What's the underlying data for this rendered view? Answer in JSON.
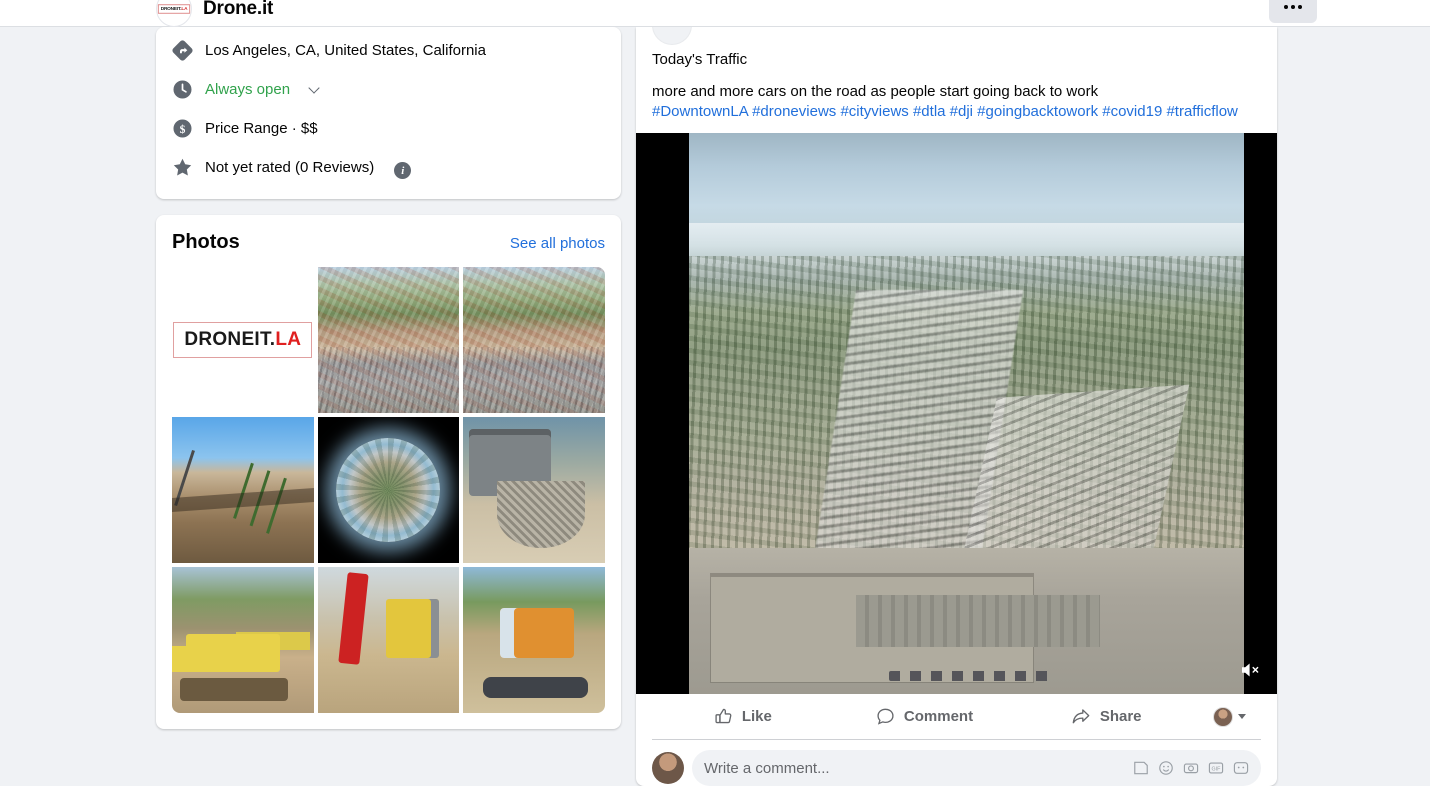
{
  "header": {
    "page_name": "Drone.it",
    "logo_black": "DRONEIT.",
    "logo_red": "LA",
    "menu_label": "···"
  },
  "sidebar": {
    "info_items": [
      {
        "icon": "directions-icon",
        "text": "Los Angeles, CA, United States, California",
        "style": "normal",
        "chevron": false,
        "info_badge": false
      },
      {
        "icon": "clock-icon",
        "text": "Always open",
        "style": "green",
        "chevron": true,
        "info_badge": false
      },
      {
        "icon": "dollar-icon",
        "text": "Price Range · $$",
        "style": "normal",
        "chevron": false,
        "info_badge": false
      },
      {
        "icon": "star-icon",
        "text": "Not yet rated (0 Reviews)",
        "style": "normal",
        "chevron": false,
        "info_badge": true
      }
    ],
    "photos": {
      "title": "Photos",
      "see_all_label": "See all photos",
      "tiles": [
        {
          "name": "droneit-logo-photo",
          "kind": "logo"
        },
        {
          "name": "aerial-neighborhood-photo-1",
          "kind": "aerial"
        },
        {
          "name": "aerial-neighborhood-photo-2",
          "kind": "aerial"
        },
        {
          "name": "construction-trench-photo",
          "kind": "trench"
        },
        {
          "name": "tiny-planet-360-photo",
          "kind": "planet"
        },
        {
          "name": "concrete-truck-worker-photo",
          "kind": "truck"
        },
        {
          "name": "yellow-excavator-photo",
          "kind": "exc-yellow"
        },
        {
          "name": "red-drill-rig-photo",
          "kind": "drill"
        },
        {
          "name": "orange-excavator-photo",
          "kind": "exc-orange"
        }
      ]
    }
  },
  "post": {
    "title_line": "Today's Traffic",
    "body_line": "more and more cars on the road as people start going back to work",
    "hashtags": "#DowntownLA #droneviews #cityviews #dtla #dji #goingbacktowork #covid19 #trafficflow",
    "video": {
      "muted": true,
      "mute_icon": "speaker-muted-icon"
    },
    "actions": [
      {
        "name": "like-button",
        "label": "Like",
        "icon": "thumbs-up-icon"
      },
      {
        "name": "comment-button",
        "label": "Comment",
        "icon": "comment-bubble-icon"
      },
      {
        "name": "share-button",
        "label": "Share",
        "icon": "share-arrow-icon"
      }
    ],
    "comment_box": {
      "placeholder": "Write a comment...",
      "icons": [
        "sticker-icon",
        "emoji-icon",
        "camera-icon",
        "gif-icon",
        "avatar-sticker-icon"
      ]
    }
  },
  "colors": {
    "link": "#216fdb",
    "open_green": "#31a24c",
    "page_bg": "#f0f2f5",
    "card_bg": "#ffffff",
    "text": "#050505",
    "secondary_text": "#65676b",
    "logo_red": "#e02020"
  }
}
